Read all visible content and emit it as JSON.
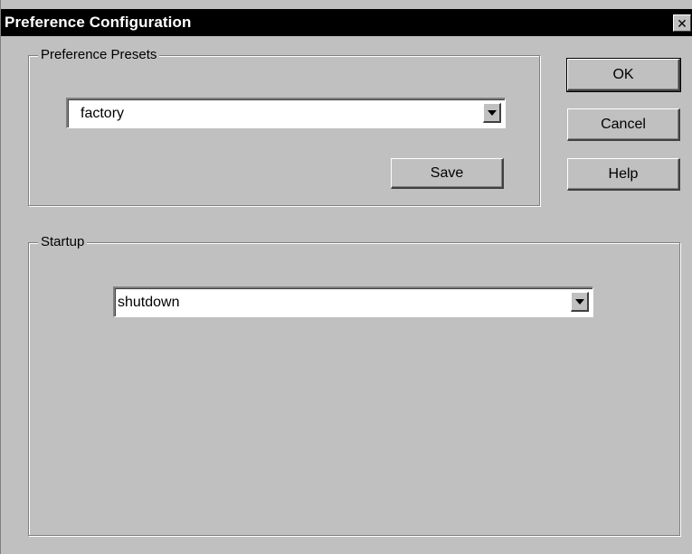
{
  "window": {
    "title": "Preference Configuration",
    "close_symbol": "✕"
  },
  "presets": {
    "legend": "Preference Presets",
    "selected": "factory",
    "save_label": "Save"
  },
  "startup": {
    "legend": "Startup",
    "selected": "shutdown"
  },
  "actions": {
    "ok_label": "OK",
    "cancel_label": "Cancel",
    "help_label": "Help"
  },
  "icons": {
    "close": "close-icon",
    "dropdown": "chevron-down-icon"
  }
}
